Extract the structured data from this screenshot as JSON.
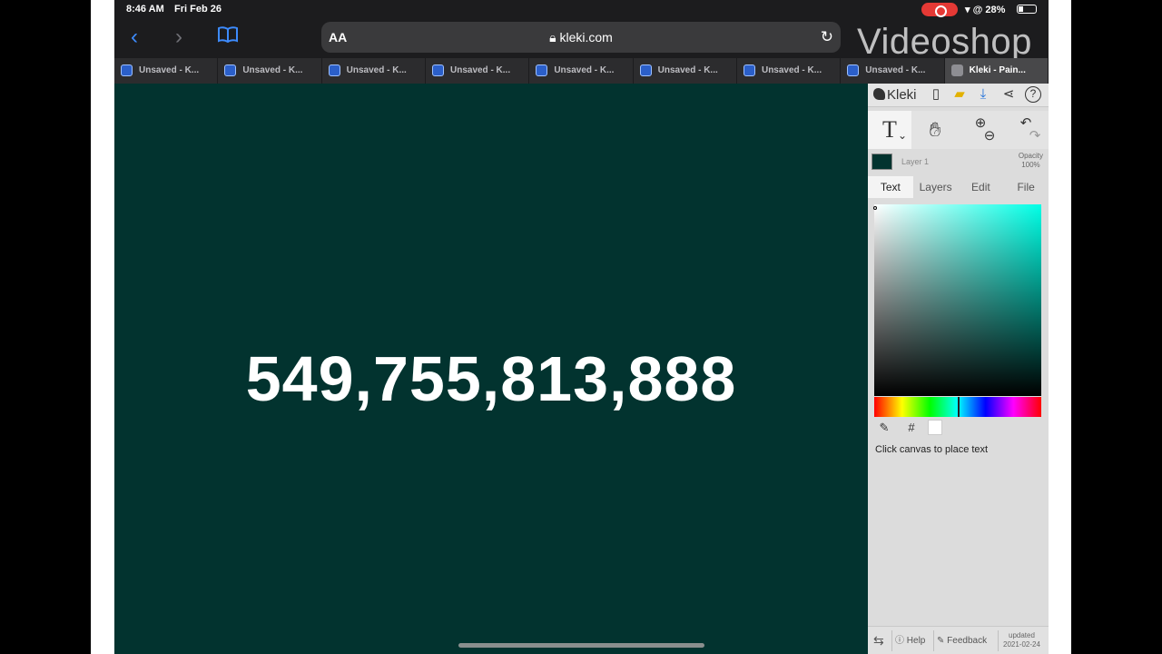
{
  "status": {
    "time": "8:46 AM",
    "date": "Fri Feb 26",
    "battery": "28%",
    "wifi_icons": "▾ @"
  },
  "browser": {
    "aa_label": "AA",
    "url": "kleki.com",
    "watermark": "Videoshop",
    "tabs": [
      {
        "title": "Unsaved - K..."
      },
      {
        "title": "Unsaved - K..."
      },
      {
        "title": "Unsaved - K..."
      },
      {
        "title": "Unsaved - K..."
      },
      {
        "title": "Unsaved - K..."
      },
      {
        "title": "Unsaved - K..."
      },
      {
        "title": "Unsaved - K..."
      },
      {
        "title": "Unsaved - K..."
      },
      {
        "title": "Kleki - Pain..."
      }
    ]
  },
  "canvas": {
    "text": "549,755,813,888",
    "background": "#02332f"
  },
  "kleki": {
    "logo": "Kleki",
    "layer": {
      "name": "Layer 1",
      "opacity_label": "Opacity",
      "opacity_value": "100%"
    },
    "tabs": [
      "Text",
      "Layers",
      "Edit",
      "File"
    ],
    "active_tab": "Text",
    "hex_label": "#",
    "hint": "Click canvas to place text",
    "footer": {
      "help": "Help",
      "feedback": "Feedback",
      "updated_label": "updated",
      "updated_date": "2021-02-24"
    },
    "hue_color": "#00ffe6"
  }
}
